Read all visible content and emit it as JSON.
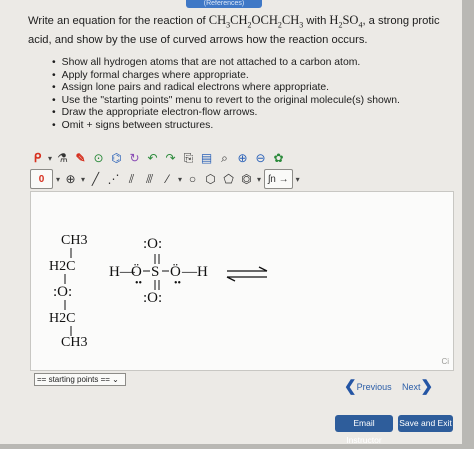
{
  "header": {
    "references_tab": "(References)"
  },
  "question": {
    "part1": "Write an equation for the reaction of ",
    "part2": " with ",
    "part3": ", a strong protic acid, and show by the use of curved arrows how the reaction occurs.",
    "bullets": [
      "Show all hydrogen atoms that are not attached to a carbon atom.",
      "Apply formal charges where appropriate.",
      "Assign lone pairs and radical electrons where appropriate.",
      "Use the \"starting points\" menu to revert to the original molecule(s) shown.",
      "Draw the appropriate electron-flow arrows.",
      "Omit + signs between structures."
    ]
  },
  "toolbar": {
    "charge_zero": "0",
    "charge_plus": "⊕",
    "sn_label": "ʃn",
    "arrow_label": "→"
  },
  "canvas": {
    "ether": {
      "top": "CH3",
      "c1": "H2C",
      "o": ":O:",
      "c2": "H2C",
      "bottom": "CH3"
    },
    "acid": {
      "h_left": "H—",
      "o_left": "Ö",
      "s": "S",
      "o_right": "Ö",
      "h_right": "—H",
      "o_top": ":O:",
      "o_bottom": ":O:"
    },
    "corner": "Ci"
  },
  "footer": {
    "starting_points": "== starting points ==",
    "previous": "Previous",
    "next": "Next",
    "email_instructor": "Email Instructor",
    "save_exit": "Save and Exit"
  },
  "colors": {
    "button_bg": "#2e5d9b",
    "link": "#2b5ea8"
  }
}
